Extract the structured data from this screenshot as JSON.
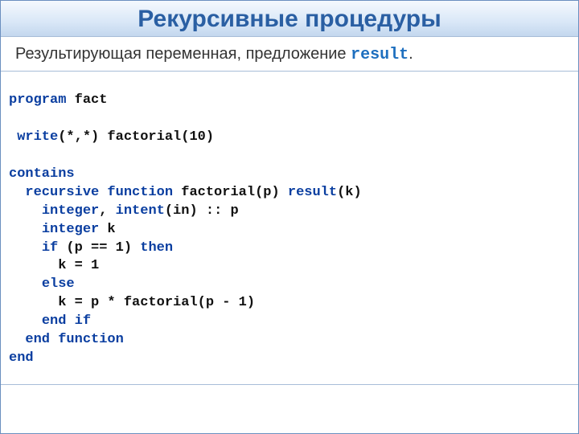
{
  "header": {
    "title": "Рекурсивные процедуры"
  },
  "subtitle": {
    "prefix": "Результирующая переменная, предложение ",
    "keyword": "result",
    "suffix": "."
  },
  "code": {
    "l1_kw": "program",
    "l1_rest": " fact",
    "l2_lead": " ",
    "l2_kw": "write",
    "l2_rest": "(*,*) factorial(10)",
    "l3_kw": "contains",
    "l4_lead": "  ",
    "l4_kw": "recursive function",
    "l4_mid": " factorial(p) ",
    "l4_kw2": "result",
    "l4_rest": "(k)",
    "l5_lead": "    ",
    "l5_kw": "integer",
    "l5_mid": ", ",
    "l5_kw2": "intent",
    "l5_rest": "(in) :: p",
    "l6_lead": "    ",
    "l6_kw": "integer",
    "l6_rest": " k",
    "l7_lead": "    ",
    "l7_kw": "if",
    "l7_mid": " (p == 1) ",
    "l7_kw2": "then",
    "l8_lead": "      ",
    "l8_rest": "k = 1",
    "l9_lead": "    ",
    "l9_kw": "else",
    "l10_lead": "      ",
    "l10_rest": "k = p * factorial(p - 1)",
    "l11_lead": "    ",
    "l11_kw": "end if",
    "l12_lead": "  ",
    "l12_kw": "end function",
    "l13_kw": "end"
  }
}
